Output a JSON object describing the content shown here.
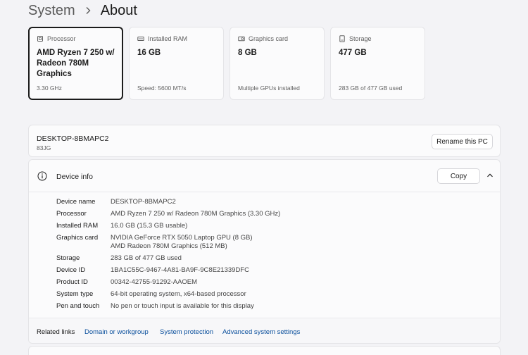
{
  "breadcrumb": {
    "parent": "System",
    "current": "About"
  },
  "tiles": [
    {
      "label": "Processor",
      "value": "AMD Ryzen 7 250 w/ Radeon 780M Graphics",
      "sub": "3.30 GHz",
      "icon": "processor-icon"
    },
    {
      "label": "Installed RAM",
      "value": "16 GB",
      "sub": "Speed: 5600 MT/s",
      "icon": "ram-icon"
    },
    {
      "label": "Graphics card",
      "value": "8 GB",
      "sub": "Multiple GPUs installed",
      "icon": "graphics-card-icon"
    },
    {
      "label": "Storage",
      "value": "477 GB",
      "sub": "283 GB of 477 GB used",
      "icon": "storage-icon"
    }
  ],
  "pc": {
    "name": "DESKTOP-8BMAPC2",
    "model": "83JG",
    "rename_label": "Rename this PC"
  },
  "device_info": {
    "title": "Device info",
    "copy_label": "Copy",
    "rows": [
      {
        "label": "Device name",
        "value": "DESKTOP-8BMAPC2"
      },
      {
        "label": "Processor",
        "value": "AMD Ryzen 7 250 w/ Radeon 780M Graphics (3.30 GHz)"
      },
      {
        "label": "Installed RAM",
        "value": "16.0 GB (15.3 GB usable)"
      },
      {
        "label": "Graphics card",
        "value": "NVIDIA GeForce RTX 5050 Laptop GPU (8 GB)",
        "value2": "AMD Radeon 780M Graphics (512 MB)"
      },
      {
        "label": "Storage",
        "value": "283 GB of 477 GB used"
      },
      {
        "label": "Device ID",
        "value": "1BA1C55C-9467-4A81-BA9F-9C8E21339DFC"
      },
      {
        "label": "Product ID",
        "value": "00342-42755-91292-AAOEM"
      },
      {
        "label": "System type",
        "value": "64-bit operating system, x64-based processor"
      },
      {
        "label": "Pen and touch",
        "value": "No pen or touch input is available for this display"
      }
    ]
  },
  "related": {
    "label": "Related links",
    "links": [
      "Domain or workgroup",
      "System protection",
      "Advanced system settings"
    ]
  },
  "colors": {
    "accent_link": "#0a4f9c",
    "background": "#f3f3f6",
    "card": "#fbfbfc"
  }
}
